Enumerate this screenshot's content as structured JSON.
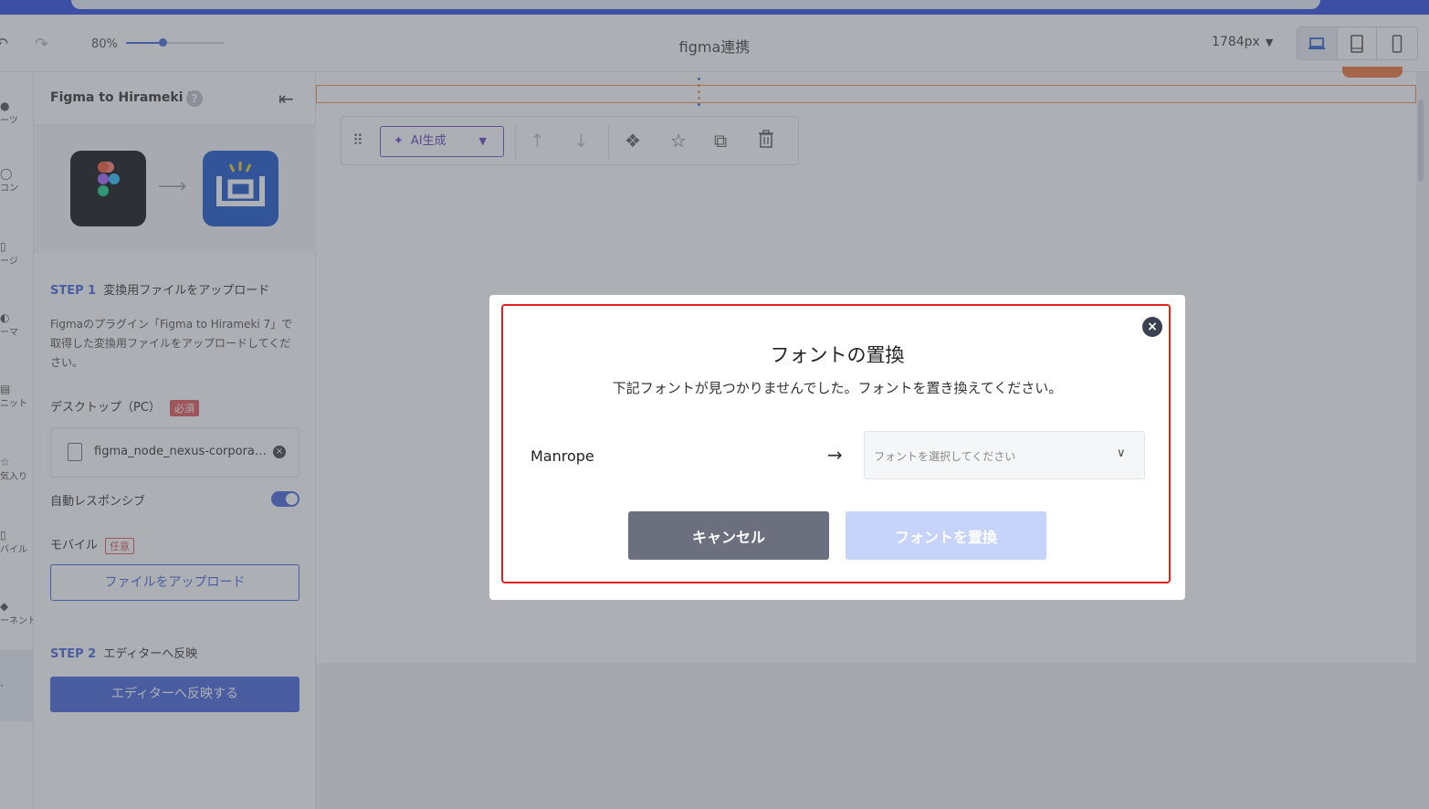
{
  "toolbar": {
    "undo_icon": "undo-icon",
    "redo_icon": "redo-icon",
    "zoom_label": "80%",
    "zoom_value": 0.37,
    "title": "figma連携",
    "width_label": "1784px",
    "devices": [
      "laptop-icon",
      "tablet-icon",
      "mobile-icon"
    ]
  },
  "rail": {
    "items": [
      {
        "label": "ーツ"
      },
      {
        "label": "コン"
      },
      {
        "label": "ージ"
      },
      {
        "label": "ーマ"
      },
      {
        "label": "ニット"
      },
      {
        "label": "気入り"
      },
      {
        "label": "バイル"
      },
      {
        "label": "ーネント"
      }
    ]
  },
  "panel": {
    "title": "Figma to Hirameki 7",
    "help": "?",
    "collapse_icon": "⇤",
    "step1_num": "STEP 1",
    "step1_label": "変換用ファイルをアップロード",
    "desc": "Figmaのプラグイン「Figma to Hirameki 7」で取得した変換用ファイルをアップロードしてください。",
    "desktop_label": "デスクトップ（PC）",
    "required": "必須",
    "file_name": "figma_node_nexus-corporate.json",
    "auto_responsive": "自動レスポンシブ",
    "mobile_label": "モバイル",
    "optional": "任意",
    "upload_button": "ファイルをアップロード",
    "step2_num": "STEP 2",
    "step2_label": "エディターへ反映",
    "apply_button": "エディターへ反映する"
  },
  "blocktools": {
    "ai_button": "AI生成"
  },
  "modal": {
    "title": "フォントの置換",
    "subtitle": "下記フォントが見つかりませんでした。フォントを置き換えてください。",
    "missing_font": "Manrope",
    "select_placeholder": "フォントを選択してください",
    "cancel_button": "キャンセル",
    "replace_button": "フォントを置換"
  },
  "colors": {
    "accent": "#3a5bd9",
    "topbar": "#1f3fe0",
    "danger": "#e02020",
    "cancel_bg": "#6b6f7e",
    "replace_disabled_bg": "#c6d3fb"
  }
}
